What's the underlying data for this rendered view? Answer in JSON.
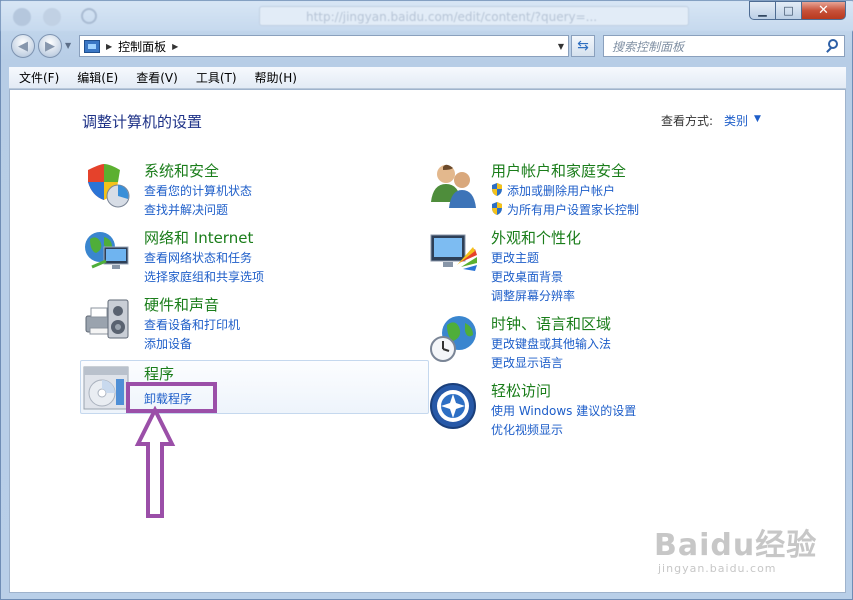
{
  "window": {
    "blurred_url": "http://jingyan.baidu.com/edit/content/?query=...",
    "caption": {
      "minimize": "▁",
      "maximize": "□",
      "close": "✕"
    }
  },
  "nav": {
    "back_glyph": "◀",
    "forward_glyph": "▶",
    "breadcrumb": [
      "控制面板"
    ],
    "refresh_glyph": "⇆"
  },
  "search": {
    "placeholder": "搜索控制面板"
  },
  "menu": [
    "文件(F)",
    "编辑(E)",
    "查看(V)",
    "工具(T)",
    "帮助(H)"
  ],
  "page": {
    "title": "调整计算机的设置",
    "view_by_label": "查看方式:",
    "view_mode": "类别"
  },
  "categories": {
    "system_security": {
      "title": "系统和安全",
      "links": [
        "查看您的计算机状态",
        "查找并解决问题"
      ]
    },
    "network": {
      "title": "网络和 Internet",
      "links": [
        "查看网络状态和任务",
        "选择家庭组和共享选项"
      ]
    },
    "hardware": {
      "title": "硬件和声音",
      "links": [
        "查看设备和打印机",
        "添加设备"
      ]
    },
    "programs": {
      "title": "程序",
      "links": [
        "卸载程序"
      ]
    },
    "user_accounts": {
      "title": "用户帐户和家庭安全",
      "links": [
        "添加或删除用户帐户",
        "为所有用户设置家长控制"
      ]
    },
    "appearance": {
      "title": "外观和个性化",
      "links": [
        "更改主题",
        "更改桌面背景",
        "调整屏幕分辨率"
      ]
    },
    "clock": {
      "title": "时钟、语言和区域",
      "links": [
        "更改键盘或其他输入法",
        "更改显示语言"
      ]
    },
    "ease": {
      "title": "轻松访问",
      "links": [
        "使用 Windows 建议的设置",
        "优化视频显示"
      ]
    }
  },
  "watermark": {
    "brand": "Baidu经验",
    "url": "jingyan.baidu.com"
  },
  "colors": {
    "category_title": "#1a7d1a",
    "link": "#1e5ec9",
    "page_title": "#1e3287",
    "annotation": "#9b4fa8"
  }
}
